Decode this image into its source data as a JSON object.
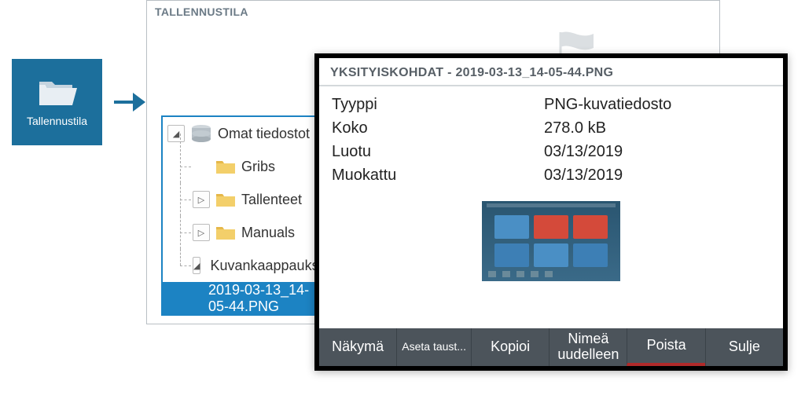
{
  "nav": {
    "label": "Tallennustila"
  },
  "panel": {
    "title": "TALLENNUSTILA"
  },
  "tree": {
    "root": "Omat tiedostot",
    "items": [
      {
        "label": "Gribs"
      },
      {
        "label": "Tallenteet"
      },
      {
        "label": "Manuals"
      },
      {
        "label": "Kuvankaappaukset"
      }
    ],
    "selected": "2019-03-13_14-05-44.PNG"
  },
  "dialog": {
    "title": "YKSITYISKOHDAT - 2019-03-13_14-05-44.PNG",
    "details": {
      "type_label": "Tyyppi",
      "type_value": "PNG-kuvatiedosto",
      "size_label": "Koko",
      "size_value": "278.0 kB",
      "created_label": "Luotu",
      "created_value": "03/13/2019",
      "modified_label": "Muokattu",
      "modified_value": "03/13/2019"
    },
    "footer": {
      "view": "Näkymä",
      "set_bg": "Aseta taust...",
      "copy": "Kopioi",
      "rename": "Nimeä uudelleen",
      "delete": "Poista",
      "close": "Sulje"
    }
  }
}
